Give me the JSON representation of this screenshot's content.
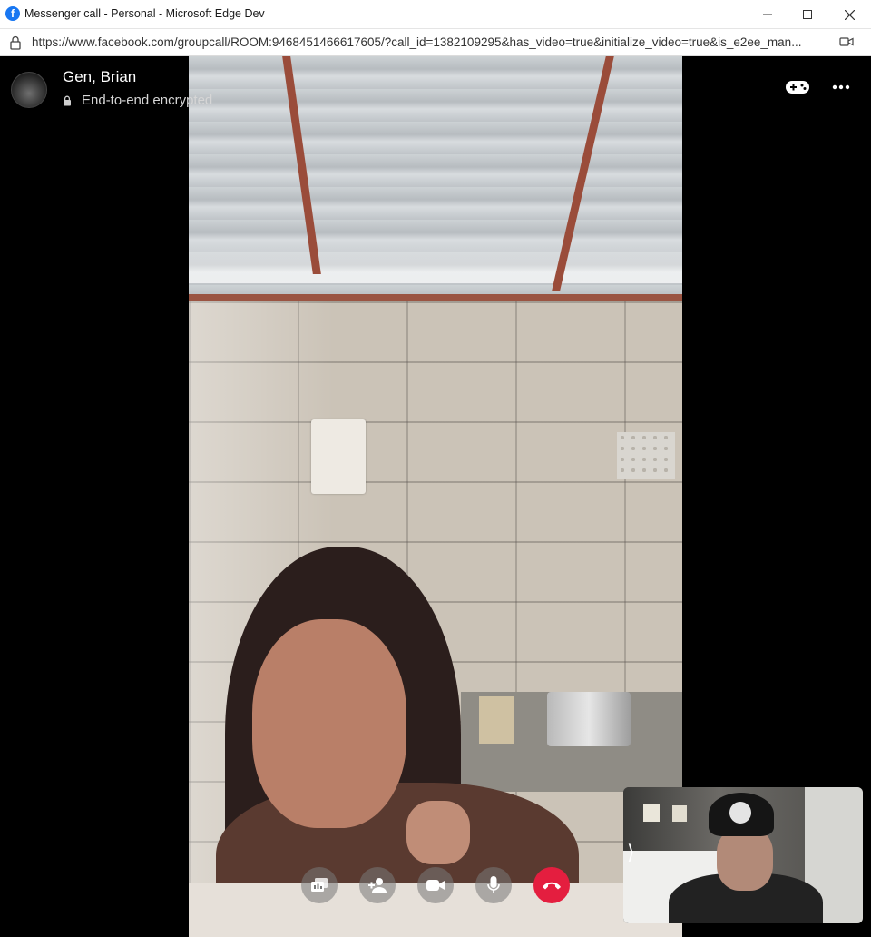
{
  "window": {
    "title": "Messenger call - Personal - Microsoft Edge Dev",
    "app_icon": "facebook-logo-icon",
    "logo_letter": "f"
  },
  "address_bar": {
    "url": "https://www.facebook.com/groupcall/ROOM:9468451466617605/?call_id=1382109295&has_video=true&initialize_video=true&is_e2ee_man..."
  },
  "call": {
    "caller_name": "Gen, Brian",
    "encryption_label": "End-to-end encrypted"
  },
  "controls": [
    {
      "name": "share-screen-button",
      "icon": "share-screen-icon"
    },
    {
      "name": "add-person-button",
      "icon": "add-person-icon"
    },
    {
      "name": "toggle-video-button",
      "icon": "video-camera-icon"
    },
    {
      "name": "toggle-mic-button",
      "icon": "microphone-icon"
    },
    {
      "name": "end-call-button",
      "icon": "end-call-icon"
    }
  ],
  "self_view": {
    "collapse_chevron": "⟩"
  },
  "colors": {
    "end_call": "#e41e3f",
    "facebook_blue": "#1877f2",
    "background": "#000000"
  }
}
